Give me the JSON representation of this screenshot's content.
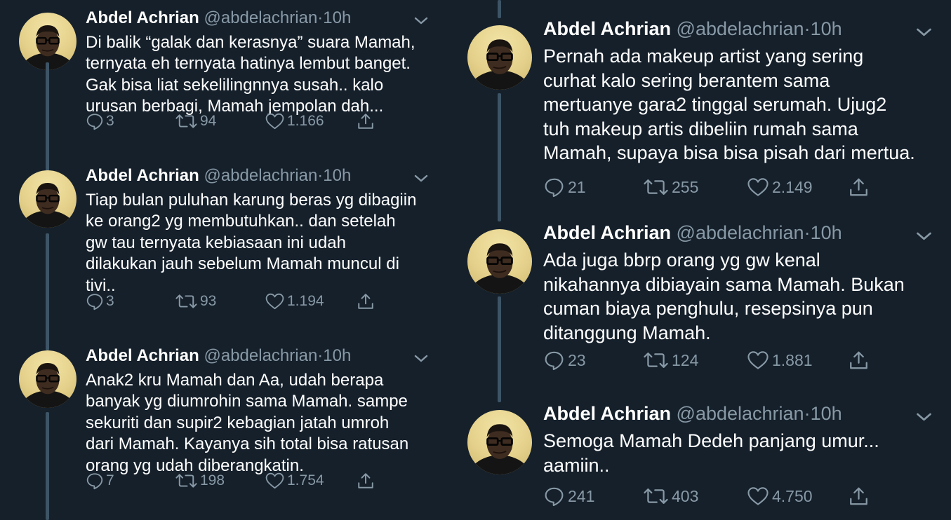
{
  "tweets_left": [
    {
      "author": {
        "name": "Abdel Achrian",
        "handle": "@abdelachrian"
      },
      "separator": "·",
      "time": "10h",
      "text": "Di balik “galak dan kerasnya” suara Mamah,\nternyata eh ternyata hatinya lembut banget.\nGak bisa liat sekelilingnnya susah.. kalo\nurusan berbagi, Mamah jempolan dah...",
      "replies": "3",
      "retweets": "94",
      "likes": "1.166"
    },
    {
      "author": {
        "name": "Abdel Achrian",
        "handle": "@abdelachrian"
      },
      "separator": "·",
      "time": "10h",
      "text": "Tiap bulan puluhan karung beras yg dibagiin\nke orang2 yg membutuhkan.. dan setelah\ngw tau ternyata kebiasaan ini udah\ndilakukan jauh sebelum Mamah muncul di\ntivi..",
      "replies": "3",
      "retweets": "93",
      "likes": "1.194"
    },
    {
      "author": {
        "name": "Abdel Achrian",
        "handle": "@abdelachrian"
      },
      "separator": "·",
      "time": "10h",
      "text": "Anak2 kru Mamah dan Aa, udah berapa\nbanyak yg diumrohin sama Mamah. sampe\nsekuriti dan supir2 kebagian jatah umroh\ndari Mamah. Kayanya sih total bisa ratusan\norang yg udah diberangkatin.",
      "replies": "7",
      "retweets": "198",
      "likes": "1.754"
    }
  ],
  "tweets_right": [
    {
      "author": {
        "name": "Abdel Achrian",
        "handle": "@abdelachrian"
      },
      "separator": "·",
      "time": "10h",
      "text": "Pernah ada makeup artist yang sering\ncurhat kalo sering berantem sama\nmertuanye gara2 tinggal serumah. Ujug2\ntuh makeup artis dibeliin rumah sama\nMamah, supaya bisa bisa pisah dari mertua.",
      "replies": "21",
      "retweets": "255",
      "likes": "2.149"
    },
    {
      "author": {
        "name": "Abdel Achrian",
        "handle": "@abdelachrian"
      },
      "separator": "·",
      "time": "10h",
      "text": "Ada juga bbrp orang yg gw kenal\nnikahannya dibiayain sama Mamah. Bukan\ncuman biaya penghulu, resepsinya pun\nditanggung Mamah.",
      "replies": "23",
      "retweets": "124",
      "likes": "1.881"
    },
    {
      "author": {
        "name": "Abdel Achrian",
        "handle": "@abdelachrian"
      },
      "separator": "·",
      "time": "10h",
      "text": "Semoga Mamah Dedeh panjang umur...\naamiin..",
      "replies": "241",
      "retweets": "403",
      "likes": "4.750"
    }
  ],
  "icons": {
    "reply": "reply-icon",
    "retweet": "retweet-icon",
    "like": "like-icon",
    "share": "share-icon",
    "menu": "chevron-down-icon"
  },
  "colors": {
    "background": "#15202b",
    "text": "#ffffff",
    "secondary": "#8899a6",
    "thread_line": "#3d5466"
  }
}
